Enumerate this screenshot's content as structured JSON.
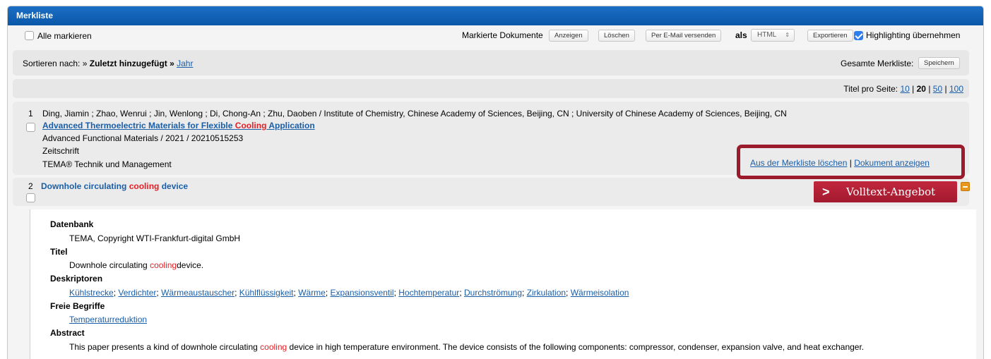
{
  "panel": {
    "title": "Merkliste"
  },
  "toolbar": {
    "select_all_label": "Alle markieren",
    "marked_docs_label": "Markierte Dokumente",
    "show_button": "Anzeigen",
    "delete_button": "Löschen",
    "email_button": "Per E-Mail versenden",
    "als_label": "als",
    "format_select_value": "HTML",
    "export_button": "Exportieren",
    "highlighting_label": "Highlighting übernehmen",
    "highlighting_checked": true
  },
  "sortbar": {
    "sort_label": "Sortieren nach: »",
    "sort_active": "Zuletzt hinzugefügt",
    "sort_sep": "»",
    "sort_link_year": "Jahr",
    "whole_list_label": "Gesamte Merkliste:",
    "save_button": "Speichern"
  },
  "pagesbar": {
    "per_page_label": "Titel pro Seite:",
    "opt_10": "10",
    "sep1": "|",
    "opt_20": "20",
    "sep2": "|",
    "opt_50": "50",
    "sep3": "|",
    "opt_100": "100"
  },
  "item1": {
    "number": "1",
    "authors": "Ding, Jiamin ; Zhao, Wenrui ; Jin, Wenlong ; Di, Chong-An ; Zhu, Daoben / Institute of Chemistry, Chinese Academy of Sciences, Beijing, CN ; University of Chinese Academy of Sciences, Beijing, CN",
    "title_pre": "Advanced Thermoelectric Materials for Flexible",
    "title_hl": "Cooling",
    "title_post": "Application",
    "source": "Advanced Functional Materials / 2021 / 20210515253",
    "doctype": "Zeitschrift",
    "database": "TEMA® Technik und Management",
    "remove_link": "Aus der Merkliste löschen",
    "sep": "|",
    "show_link": "Dokument anzeigen"
  },
  "item2": {
    "number": "2",
    "title_pre": "Downhole circulating",
    "title_hl": "cooling",
    "title_post": "device",
    "volltext_chevron": ">",
    "volltext_label": "Volltext-Angebot"
  },
  "detail": {
    "db_label": "Datenbank",
    "db_value": "TEMA, Copyright WTI-Frankfurt-digital GmbH",
    "title_label": "Titel",
    "title_pre": "Downhole circulating",
    "title_hl": "cooling",
    "title_post": "device.",
    "descriptors_label": "Deskriptoren",
    "descriptors": [
      "Kühlstrecke",
      "Verdichter",
      "Wärmeaustauscher",
      "Kühlflüssigkeit",
      "Wärme",
      "Expansionsventil",
      "Hochtemperatur",
      "Durchströmung",
      "Zirkulation",
      "Wärmeisolation"
    ],
    "desc_sep": ";",
    "free_terms_label": "Freie Begriffe",
    "free_terms": [
      "Temperaturreduktion"
    ],
    "abstract_label": "Abstract",
    "abstract_pre": "This paper presents a kind of downhole circulating",
    "abstract_hl": "cooling",
    "abstract_post": "device in high temperature environment. The device consists of the following components: compressor, condenser, expansion valve, and heat exchanger."
  },
  "colors": {
    "header_blue": "#0a57a8",
    "link_blue": "#1a5ea8",
    "highlight_red": "#e41f26",
    "frame_red": "#9b1b2c",
    "volltext_red": "#b0203a",
    "minus_orange": "#e8971d"
  },
  "icons": {
    "select_arrows": "up-down-arrows-icon",
    "minus": "minus-square-icon",
    "volltext_chevron": "chevron-right-icon"
  }
}
